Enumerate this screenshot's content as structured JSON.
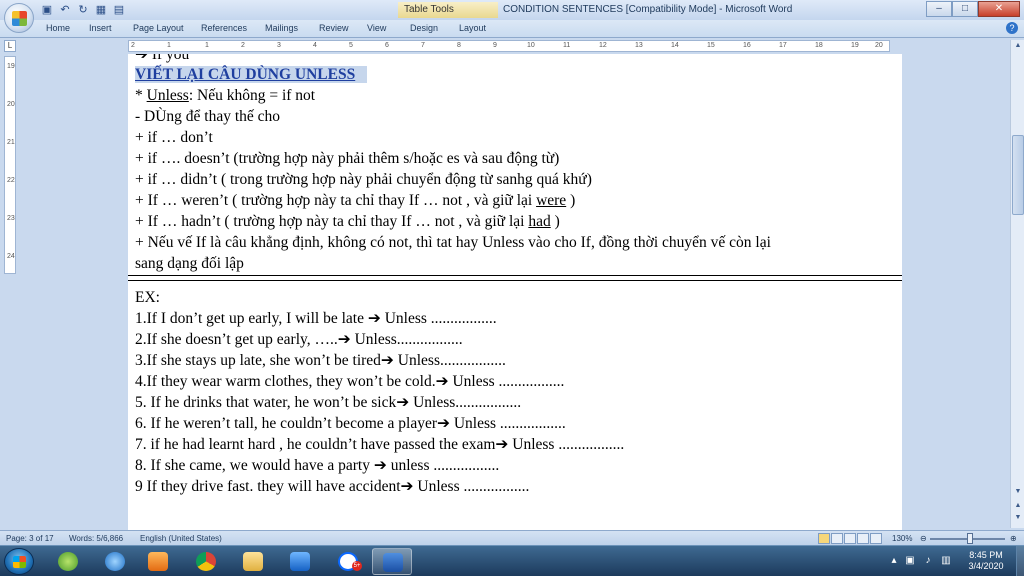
{
  "window": {
    "title": "CONDITION  SENTENCES [Compatibility Mode] - Microsoft Word",
    "contextual_tab_group": "Table Tools",
    "controls": [
      "–",
      "□",
      "✕"
    ]
  },
  "quick_access": [
    "save-icon",
    "undo-icon",
    "redo-icon",
    "table-icon",
    "open-icon"
  ],
  "ribbon": {
    "tabs": [
      "Home",
      "Insert",
      "Page Layout",
      "References",
      "Mailings",
      "Review",
      "View",
      "Design",
      "Layout"
    ],
    "help": "?"
  },
  "ruler": {
    "corner": "L",
    "top_ticks": [
      "2",
      "1",
      "1",
      "2",
      "3",
      "4",
      "5",
      "6",
      "7",
      "8",
      "9",
      "10",
      "11",
      "12",
      "13",
      "14",
      "15",
      "16",
      "17",
      "18",
      "19",
      "20"
    ],
    "left_ticks": [
      "19",
      "20",
      "21",
      "22",
      "23",
      "24"
    ]
  },
  "document": {
    "cut_line": "➔ If you",
    "heading": "VIẾT LẠI CÂU DÙNG UNLESS",
    "lines": [
      {
        "prefix": "* ",
        "underlined": "Unless",
        "rest": ": Nếu không = if not"
      },
      {
        "text": "- DÙng để thay thế cho"
      },
      {
        "text": "+ if … don’t"
      },
      {
        "text": "+ if …. doesn’t (trường hợp này phải thêm s/hoặc es và sau động từ)"
      },
      {
        "text": "+ if … didn’t ( trong trường hợp này phải chuyển động từ sanhg quá khứ)"
      },
      {
        "prefix": "+ If … weren’t ( trường hợp này ta chỉ thay If  … not , và giữ lại ",
        "underlined": "were",
        "rest": " )"
      },
      {
        "prefix": "+ If … hadn’t ( trường hợp này ta chỉ thay If  … not , và giữ lại ",
        "underlined": "had",
        "rest": " )"
      },
      {
        "text": "+ Nếu vế If là câu khẳng định, không có not, thì tat hay Unless vào cho If, đồng thời chuyển vế còn lại"
      },
      {
        "text": "sang dạng đối lập"
      }
    ],
    "example_label": "EX:",
    "examples": [
      "1.If  I don’t get up early, I will be late ➔ Unless .................",
      "2.If she doesn’t get up early, …..➔ Unless.................",
      "3.If she stays up late, she won’t be tired➔ Unless.................",
      " 4.If they  wear warm clothes, they won’t be cold.➔ Unless .................",
      "5. If he drinks that water, he won’t be sick➔ Unless.................",
      "6. If he weren’t tall, he couldn’t become a player➔ Unless  .................",
      "7. if he had learnt hard , he couldn’t have passed the exam➔ Unless .................",
      "8. If she came, we would have a party ➔ unless .................",
      "9 If they drive fast. they will have accident➔ Unless  ................."
    ]
  },
  "statusbar": {
    "page": "Page: 3 of 17",
    "words": "Words: 5/6,866",
    "language": "English (United States)",
    "zoom": "130%"
  },
  "taskbar": {
    "apps": [
      "start-button",
      "coccoc-icon",
      "ie-icon",
      "media-icon",
      "chrome-icon",
      "explorer-icon",
      "teamviewer-icon",
      "zalo-icon",
      "word-icon"
    ],
    "zalo_badge": "5+",
    "time": "8:45 PM",
    "date": "3/4/2020"
  }
}
